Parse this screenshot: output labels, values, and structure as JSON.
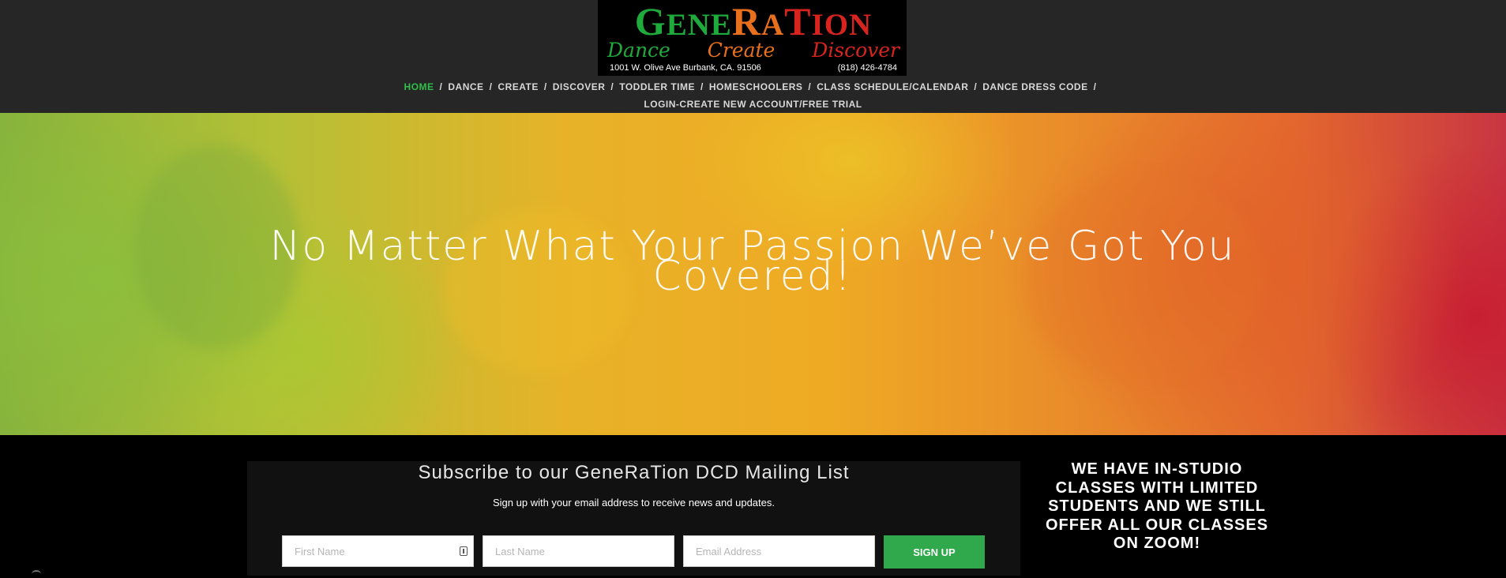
{
  "logo": {
    "brand_parts": [
      "G",
      "ENE",
      "R",
      "A",
      "T",
      "ION"
    ],
    "tagline": [
      "Dance",
      "Create",
      "Discover"
    ],
    "address": "1001 W. Olive Ave Burbank, CA. 91506",
    "phone": "(818) 426-4784"
  },
  "nav": {
    "row1": [
      "HOME",
      "DANCE",
      "CREATE",
      "DISCOVER",
      "TODDLER TIME",
      "HOMESCHOOLERS",
      "CLASS SCHEDULE/CALENDAR",
      "DANCE DRESS CODE"
    ],
    "row2": [
      "LOGIN-CREATE NEW ACCOUNT/FREE TRIAL"
    ],
    "separator": "/",
    "active_color": "#2fbf4a"
  },
  "hero": {
    "title": "No Matter What Your Passion We’ve Got You Covered!"
  },
  "subscribe": {
    "title": "Subscribe to our GeneRaTion DCD Mailing List",
    "description": "Sign up with your email address to receive news and updates.",
    "first_name_placeholder": "First Name",
    "last_name_placeholder": "Last Name",
    "email_placeholder": "Email Address",
    "button_label": "SIGN UP",
    "button_color": "#2fa94b"
  },
  "notice": {
    "text": "WE HAVE IN-STUDIO CLASSES WITH LIMITED STUDENTS AND WE STILL OFFER ALL OUR CLASSES ON ZOOM!"
  }
}
